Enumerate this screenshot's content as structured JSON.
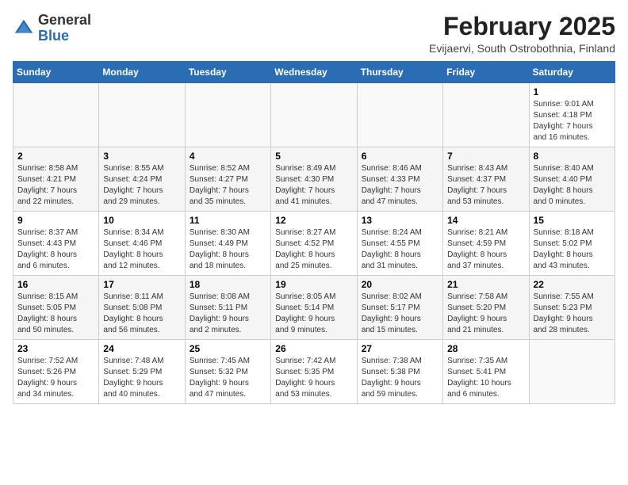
{
  "header": {
    "logo_general": "General",
    "logo_blue": "Blue",
    "month_year": "February 2025",
    "location": "Evijaervi, South Ostrobothnia, Finland"
  },
  "weekdays": [
    "Sunday",
    "Monday",
    "Tuesday",
    "Wednesday",
    "Thursday",
    "Friday",
    "Saturday"
  ],
  "weeks": [
    [
      {
        "day": "",
        "info": ""
      },
      {
        "day": "",
        "info": ""
      },
      {
        "day": "",
        "info": ""
      },
      {
        "day": "",
        "info": ""
      },
      {
        "day": "",
        "info": ""
      },
      {
        "day": "",
        "info": ""
      },
      {
        "day": "1",
        "info": "Sunrise: 9:01 AM\nSunset: 4:18 PM\nDaylight: 7 hours\nand 16 minutes."
      }
    ],
    [
      {
        "day": "2",
        "info": "Sunrise: 8:58 AM\nSunset: 4:21 PM\nDaylight: 7 hours\nand 22 minutes."
      },
      {
        "day": "3",
        "info": "Sunrise: 8:55 AM\nSunset: 4:24 PM\nDaylight: 7 hours\nand 29 minutes."
      },
      {
        "day": "4",
        "info": "Sunrise: 8:52 AM\nSunset: 4:27 PM\nDaylight: 7 hours\nand 35 minutes."
      },
      {
        "day": "5",
        "info": "Sunrise: 8:49 AM\nSunset: 4:30 PM\nDaylight: 7 hours\nand 41 minutes."
      },
      {
        "day": "6",
        "info": "Sunrise: 8:46 AM\nSunset: 4:33 PM\nDaylight: 7 hours\nand 47 minutes."
      },
      {
        "day": "7",
        "info": "Sunrise: 8:43 AM\nSunset: 4:37 PM\nDaylight: 7 hours\nand 53 minutes."
      },
      {
        "day": "8",
        "info": "Sunrise: 8:40 AM\nSunset: 4:40 PM\nDaylight: 8 hours\nand 0 minutes."
      }
    ],
    [
      {
        "day": "9",
        "info": "Sunrise: 8:37 AM\nSunset: 4:43 PM\nDaylight: 8 hours\nand 6 minutes."
      },
      {
        "day": "10",
        "info": "Sunrise: 8:34 AM\nSunset: 4:46 PM\nDaylight: 8 hours\nand 12 minutes."
      },
      {
        "day": "11",
        "info": "Sunrise: 8:30 AM\nSunset: 4:49 PM\nDaylight: 8 hours\nand 18 minutes."
      },
      {
        "day": "12",
        "info": "Sunrise: 8:27 AM\nSunset: 4:52 PM\nDaylight: 8 hours\nand 25 minutes."
      },
      {
        "day": "13",
        "info": "Sunrise: 8:24 AM\nSunset: 4:55 PM\nDaylight: 8 hours\nand 31 minutes."
      },
      {
        "day": "14",
        "info": "Sunrise: 8:21 AM\nSunset: 4:59 PM\nDaylight: 8 hours\nand 37 minutes."
      },
      {
        "day": "15",
        "info": "Sunrise: 8:18 AM\nSunset: 5:02 PM\nDaylight: 8 hours\nand 43 minutes."
      }
    ],
    [
      {
        "day": "16",
        "info": "Sunrise: 8:15 AM\nSunset: 5:05 PM\nDaylight: 8 hours\nand 50 minutes."
      },
      {
        "day": "17",
        "info": "Sunrise: 8:11 AM\nSunset: 5:08 PM\nDaylight: 8 hours\nand 56 minutes."
      },
      {
        "day": "18",
        "info": "Sunrise: 8:08 AM\nSunset: 5:11 PM\nDaylight: 9 hours\nand 2 minutes."
      },
      {
        "day": "19",
        "info": "Sunrise: 8:05 AM\nSunset: 5:14 PM\nDaylight: 9 hours\nand 9 minutes."
      },
      {
        "day": "20",
        "info": "Sunrise: 8:02 AM\nSunset: 5:17 PM\nDaylight: 9 hours\nand 15 minutes."
      },
      {
        "day": "21",
        "info": "Sunrise: 7:58 AM\nSunset: 5:20 PM\nDaylight: 9 hours\nand 21 minutes."
      },
      {
        "day": "22",
        "info": "Sunrise: 7:55 AM\nSunset: 5:23 PM\nDaylight: 9 hours\nand 28 minutes."
      }
    ],
    [
      {
        "day": "23",
        "info": "Sunrise: 7:52 AM\nSunset: 5:26 PM\nDaylight: 9 hours\nand 34 minutes."
      },
      {
        "day": "24",
        "info": "Sunrise: 7:48 AM\nSunset: 5:29 PM\nDaylight: 9 hours\nand 40 minutes."
      },
      {
        "day": "25",
        "info": "Sunrise: 7:45 AM\nSunset: 5:32 PM\nDaylight: 9 hours\nand 47 minutes."
      },
      {
        "day": "26",
        "info": "Sunrise: 7:42 AM\nSunset: 5:35 PM\nDaylight: 9 hours\nand 53 minutes."
      },
      {
        "day": "27",
        "info": "Sunrise: 7:38 AM\nSunset: 5:38 PM\nDaylight: 9 hours\nand 59 minutes."
      },
      {
        "day": "28",
        "info": "Sunrise: 7:35 AM\nSunset: 5:41 PM\nDaylight: 10 hours\nand 6 minutes."
      },
      {
        "day": "",
        "info": ""
      }
    ]
  ]
}
